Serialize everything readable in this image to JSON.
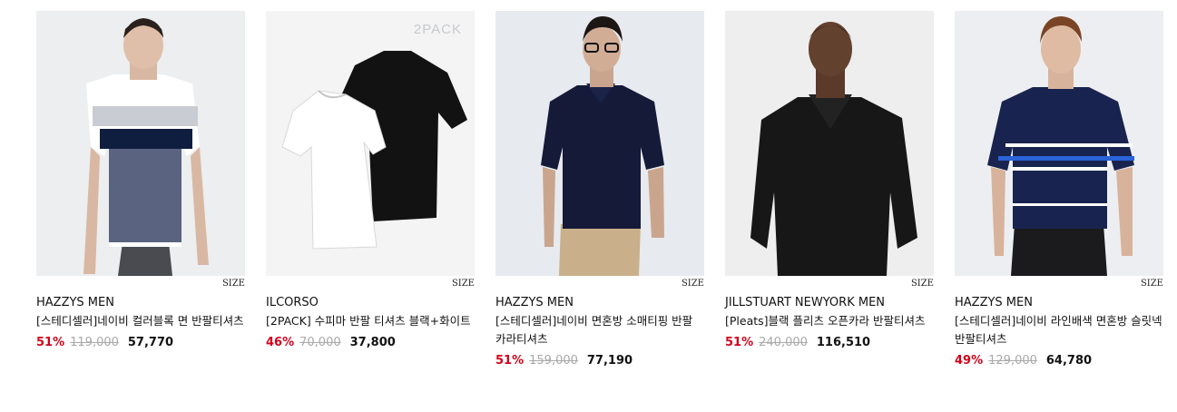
{
  "products": [
    {
      "brand": "HAZZYS MEN",
      "title": "[스테디셀러]네이비 컬러블록 면 반팔티셔츠",
      "size_label": "SIZE",
      "discount": "51%",
      "original_price": "119,000",
      "sale_price": "57,770",
      "badge": ""
    },
    {
      "brand": "ILCORSO",
      "title": "[2PACK] 수피마 반팔 티셔츠 블랙+화이트",
      "size_label": "SIZE",
      "discount": "46%",
      "original_price": "70,000",
      "sale_price": "37,800",
      "badge": "2PACK"
    },
    {
      "brand": "HAZZYS MEN",
      "title": "[스테디셀러]네이비 면혼방 소매티핑 반팔 카라티셔츠",
      "size_label": "SIZE",
      "discount": "51%",
      "original_price": "159,000",
      "sale_price": "77,190",
      "badge": ""
    },
    {
      "brand": "JILLSTUART NEWYORK MEN",
      "title": "[Pleats]블랙 플리츠 오픈카라 반팔티셔츠",
      "size_label": "SIZE",
      "discount": "51%",
      "original_price": "240,000",
      "sale_price": "116,510",
      "badge": ""
    },
    {
      "brand": "HAZZYS MEN",
      "title": "[스테디셀러]네이비 라인배색 면혼방 슬릿넥 반팔티셔츠",
      "size_label": "SIZE",
      "discount": "49%",
      "original_price": "129,000",
      "sale_price": "64,780",
      "badge": ""
    }
  ],
  "colors": {
    "discount": "#d0021b",
    "original_price": "#a9a9a9",
    "text": "#111111"
  }
}
